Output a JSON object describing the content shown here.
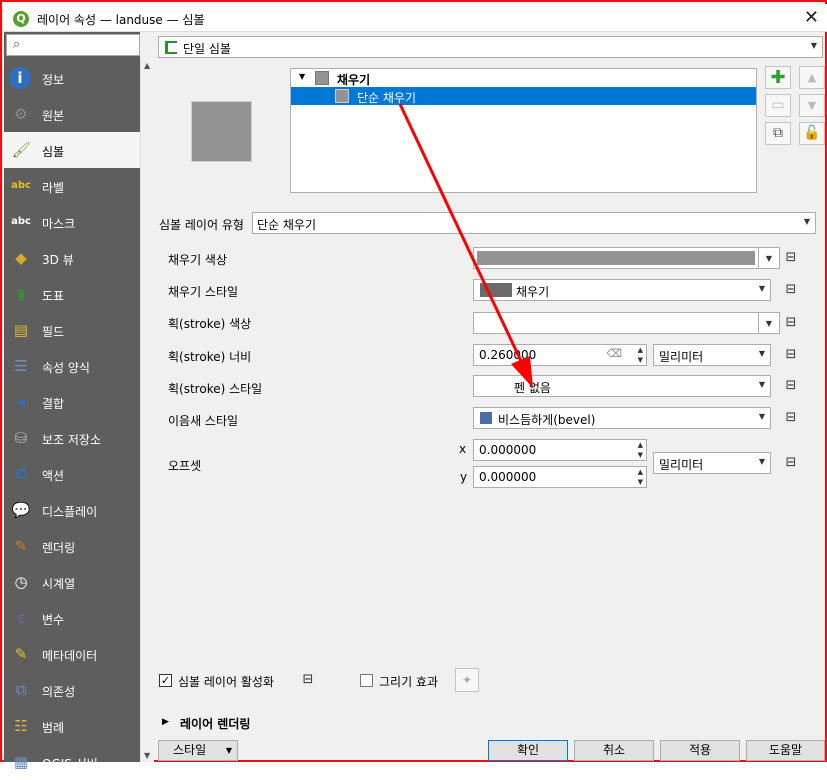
{
  "window": {
    "title": "레이어 속성 — landuse — 심볼",
    "close_glyph": "✕"
  },
  "sidebar": {
    "search_placeholder": "",
    "items": [
      {
        "label": "정보",
        "icon": "info-icon",
        "glyph": "i",
        "color": "#2f6fbf"
      },
      {
        "label": "원본",
        "icon": "source-icon",
        "glyph": "⚙",
        "color": "#8b8b8b"
      },
      {
        "label": "심볼",
        "icon": "symbology-icon",
        "glyph": "🖌",
        "color": "#6a9e3f"
      },
      {
        "label": "라벨",
        "icon": "labels-icon",
        "glyph": "abc",
        "color": "#e3c21f"
      },
      {
        "label": "마스크",
        "icon": "mask-icon",
        "glyph": "abc",
        "color": "#ffffff"
      },
      {
        "label": "3D 뷰",
        "icon": "3d-view-icon",
        "glyph": "◆",
        "color": "#d8a826"
      },
      {
        "label": "도표",
        "icon": "diagram-icon",
        "glyph": "▮",
        "color": "#3b8a3b"
      },
      {
        "label": "필드",
        "icon": "fields-icon",
        "glyph": "▤",
        "color": "#e3b431"
      },
      {
        "label": "속성 양식",
        "icon": "attributes-form-icon",
        "glyph": "☰",
        "color": "#6a90c2"
      },
      {
        "label": "결합",
        "icon": "joins-icon",
        "glyph": "◂",
        "color": "#2f6fbf"
      },
      {
        "label": "보조 저장소",
        "icon": "auxiliary-storage-icon",
        "glyph": "⛁",
        "color": "#b5b5b5"
      },
      {
        "label": "액션",
        "icon": "actions-icon",
        "glyph": "⚙",
        "color": "#2f6fbf"
      },
      {
        "label": "디스플레이",
        "icon": "display-icon",
        "glyph": "💬",
        "color": "#e3c21f"
      },
      {
        "label": "렌더링",
        "icon": "rendering-icon",
        "glyph": "✎",
        "color": "#c97f1f"
      },
      {
        "label": "시계열",
        "icon": "temporal-icon",
        "glyph": "◷",
        "color": "#ffffff"
      },
      {
        "label": "변수",
        "icon": "variables-icon",
        "glyph": "ε",
        "color": "#7b5aa6"
      },
      {
        "label": "메타데이터",
        "icon": "metadata-icon",
        "glyph": "✎",
        "color": "#e3c21f"
      },
      {
        "label": "의존성",
        "icon": "dependencies-icon",
        "glyph": "⧉",
        "color": "#6a90c2"
      },
      {
        "label": "범례",
        "icon": "legend-icon",
        "glyph": "☷",
        "color": "#e3b431"
      },
      {
        "label": "QGIS 서버",
        "icon": "qgis-server-icon",
        "glyph": "▦",
        "color": "#6a90c2"
      }
    ]
  },
  "renderer": {
    "label": "단일 심볼"
  },
  "tree": {
    "root": "채우기",
    "child": "단순 채우기"
  },
  "symbol_layer_type": {
    "label": "심볼 레이어 유형",
    "value": "단순 채우기"
  },
  "props": {
    "fill_color": "채우기 색상",
    "fill_style": "채우기 스타일",
    "fill_style_value": "채우기",
    "stroke_color": "획(stroke) 색상",
    "stroke_width": "획(stroke) 너비",
    "stroke_width_value": "0.260000",
    "stroke_width_unit": "밀리미터",
    "stroke_style": "획(stroke) 스타일",
    "stroke_style_value": "펜 없음",
    "join_style": "이음새 스타일",
    "join_style_value": "비스듬하게(bevel)",
    "offset": "오프셋",
    "offset_x_label": "x",
    "offset_x": "0.000000",
    "offset_y_label": "y",
    "offset_y": "0.000000",
    "offset_unit": "밀리미터"
  },
  "enable_layer": "심볼 레이어 활성화",
  "draw_effects": "그리기 효과",
  "layer_rendering": "레이어 렌더링",
  "buttons": {
    "style": "스타일",
    "ok": "확인",
    "cancel": "취소",
    "apply": "적용",
    "help": "도움말"
  },
  "colors": {
    "fill": "#939393",
    "selection": "#0078d7",
    "annotation_arrow": "#ff0000",
    "frame": "#e81010"
  }
}
